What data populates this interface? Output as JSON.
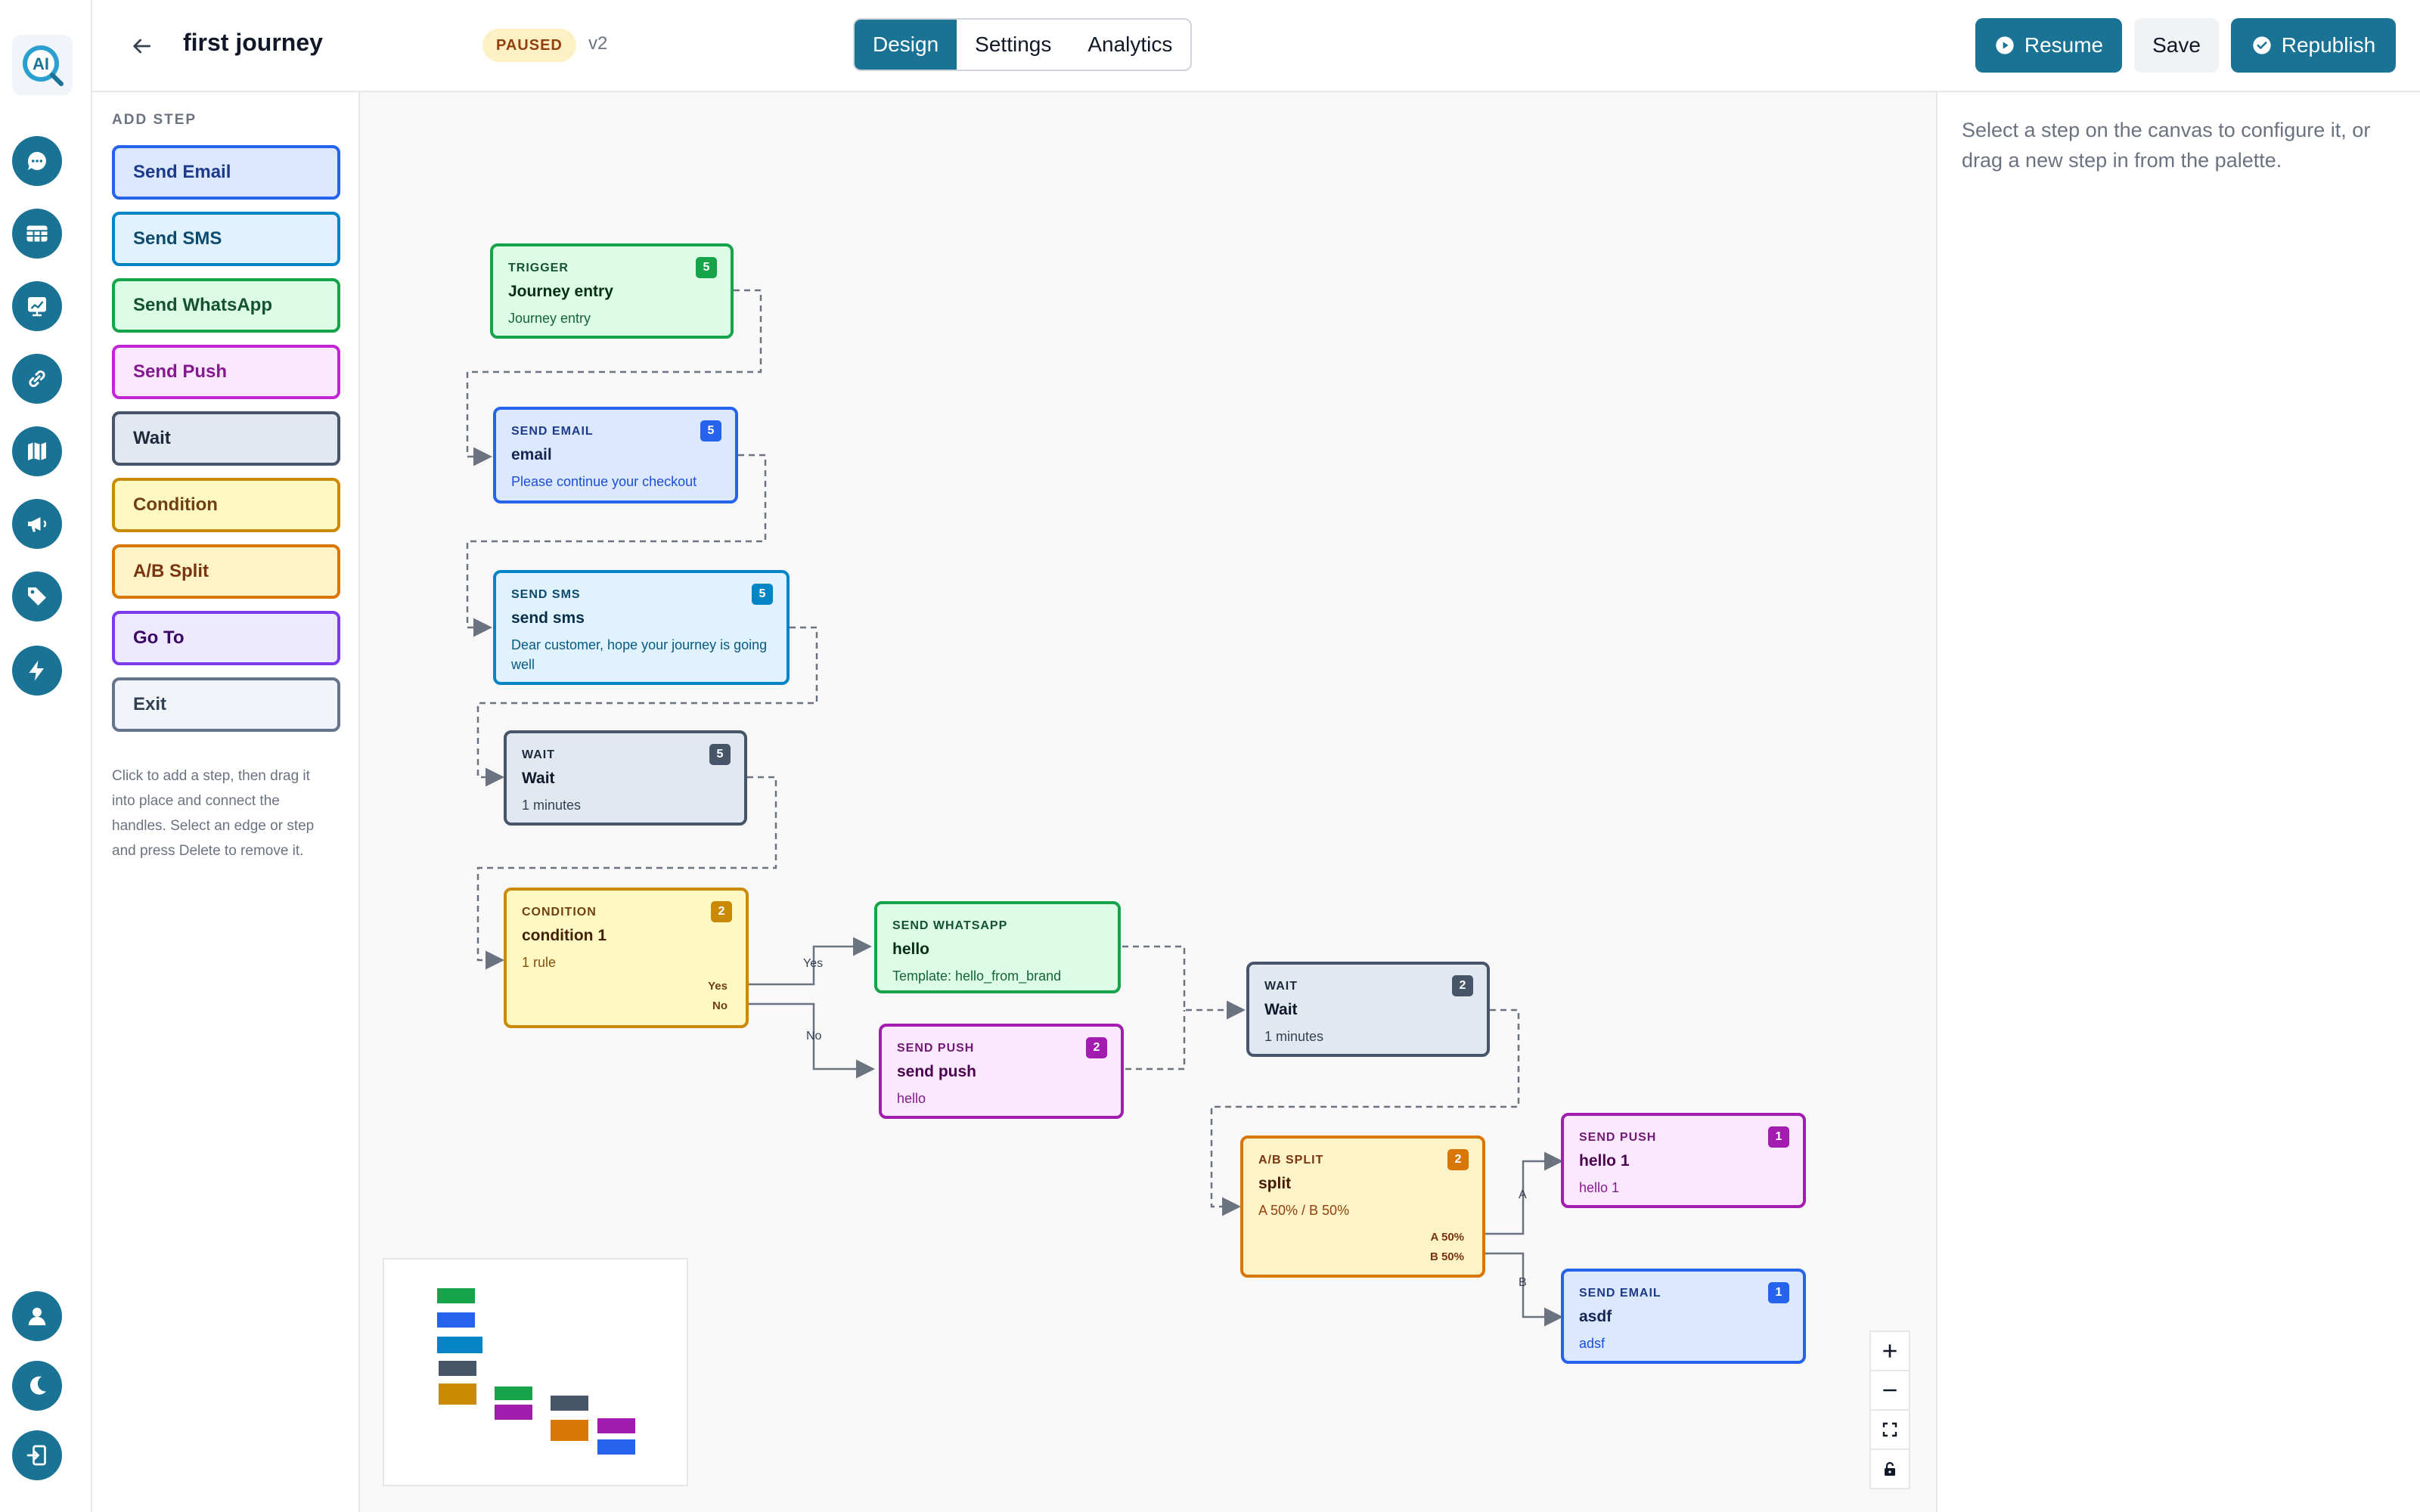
{
  "header": {
    "title": "first journey",
    "status": "PAUSED",
    "version": "v2",
    "tabs": [
      "Design",
      "Settings",
      "Analytics"
    ],
    "resume_label": "Resume",
    "save_label": "Save",
    "republish_label": "Republish"
  },
  "palette": {
    "heading": "ADD STEP",
    "items": [
      "Send Email",
      "Send SMS",
      "Send WhatsApp",
      "Send Push",
      "Wait",
      "Condition",
      "A/B Split",
      "Go To",
      "Exit"
    ],
    "help": "Click to add a step, then drag it into place and connect the handles. Select an edge or step and press Delete to remove it."
  },
  "nodes": {
    "trigger": {
      "type": "TRIGGER",
      "title": "Journey entry",
      "sub": "Journey entry",
      "badge": "5"
    },
    "email": {
      "type": "SEND EMAIL",
      "title": "email",
      "sub": "Please continue your checkout",
      "badge": "5"
    },
    "sms": {
      "type": "SEND SMS",
      "title": "send sms",
      "sub": "Dear customer, hope your journey is going well",
      "badge": "5"
    },
    "wait1": {
      "type": "WAIT",
      "title": "Wait",
      "sub": "1 minutes",
      "badge": "5"
    },
    "condition": {
      "type": "CONDITION",
      "title": "condition 1",
      "sub": "1 rule",
      "badge": "2",
      "out_yes": "Yes",
      "out_no": "No"
    },
    "whatsapp": {
      "type": "SEND WHATSAPP",
      "title": "hello",
      "sub": "Template: hello_from_brand"
    },
    "push1": {
      "type": "SEND PUSH",
      "title": "send push",
      "sub": "hello",
      "badge": "2"
    },
    "wait2": {
      "type": "WAIT",
      "title": "Wait",
      "sub": "1 minutes",
      "badge": "2"
    },
    "split": {
      "type": "A/B SPLIT",
      "title": "split",
      "sub": "A 50% / B 50%",
      "badge": "2",
      "out_a": "A 50%",
      "out_b": "B 50%"
    },
    "push2": {
      "type": "SEND PUSH",
      "title": "hello 1",
      "sub": "hello 1",
      "badge": "1"
    },
    "email2": {
      "type": "SEND EMAIL",
      "title": "asdf",
      "sub": "adsf",
      "badge": "1"
    }
  },
  "edge_labels": {
    "yes": "Yes",
    "no": "No",
    "a": "A",
    "b": "B"
  },
  "inspector": {
    "placeholder": "Select a step on the canvas to configure it, or drag a new step in from the palette."
  },
  "colors": {
    "primary": "#1a7394",
    "email": "#2563eb",
    "sms": "#0284c7",
    "whatsapp": "#16a34a",
    "push": "#a21caf",
    "wait": "#475569",
    "condition": "#ca8a04",
    "split": "#d97706",
    "goto": "#7c3aed"
  },
  "icons": [
    "chat-icon",
    "table-icon",
    "chart-icon",
    "link-icon",
    "map-icon",
    "megaphone-icon",
    "tag-icon",
    "lightning-icon",
    "user-icon",
    "moon-icon",
    "logout-icon"
  ]
}
